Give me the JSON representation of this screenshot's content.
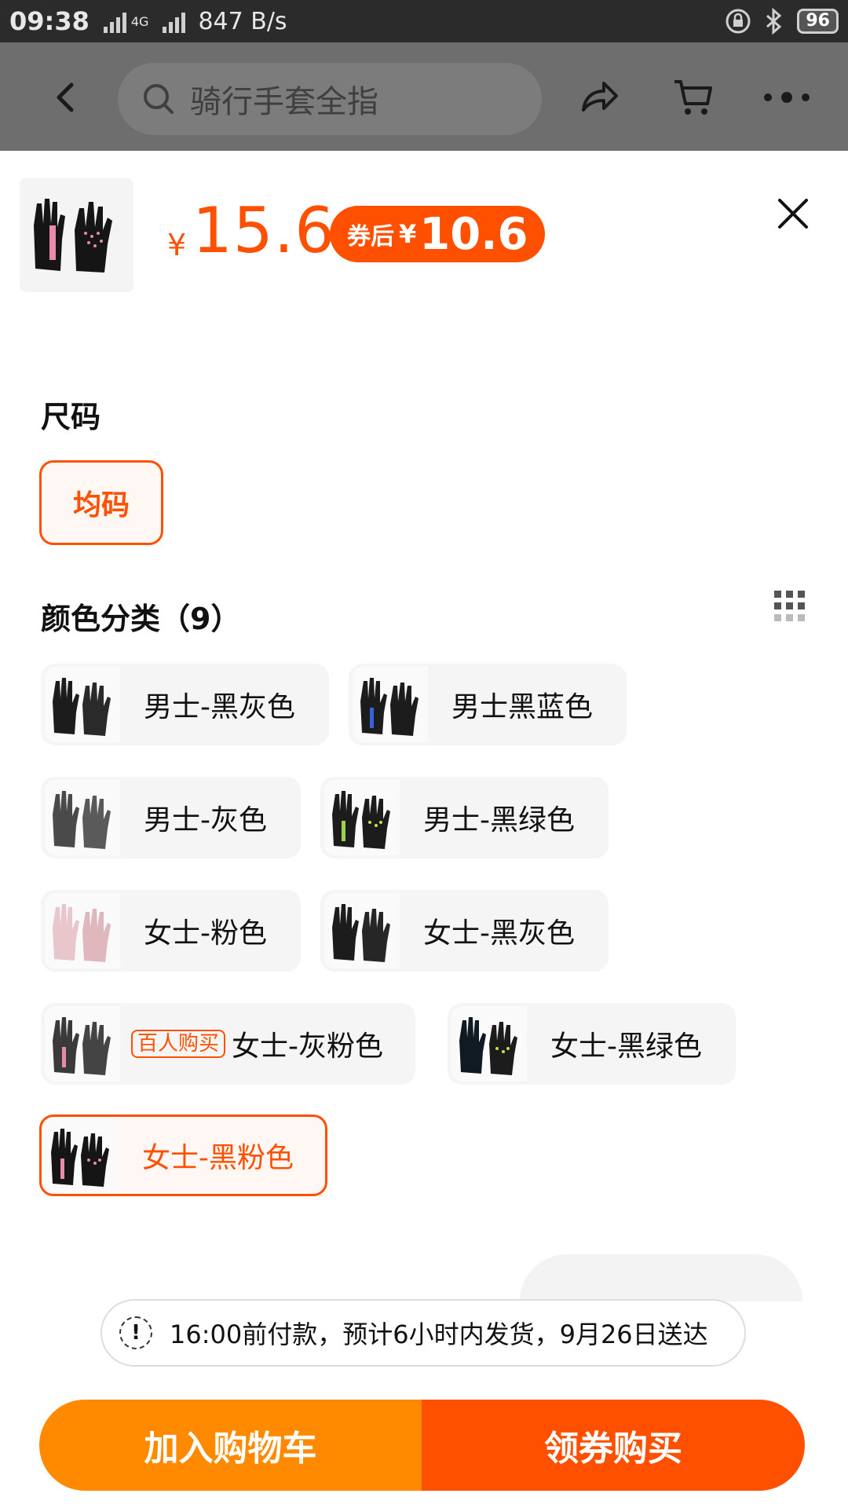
{
  "status_bar": {
    "time": "09:38",
    "network": "4G",
    "speed": "847 B/s",
    "battery": "96"
  },
  "header": {
    "search_placeholder": "骑行手套全指",
    "icons": [
      "back-icon",
      "search-icon",
      "share-icon",
      "cart-icon",
      "more-icon"
    ]
  },
  "product": {
    "price_symbol": "¥",
    "price": "15.6",
    "coupon_label": "券后",
    "coupon_symbol": "¥",
    "coupon_price": "10.6"
  },
  "size_section": {
    "title": "尺码",
    "options": [
      "均码"
    ]
  },
  "color_section": {
    "title": "颜色分类（9）",
    "options": [
      {
        "label": "男士-黑灰色"
      },
      {
        "label": "男士黑蓝色"
      },
      {
        "label": "男士-灰色"
      },
      {
        "label": "男士-黑绿色"
      },
      {
        "label": "女士-粉色"
      },
      {
        "label": "女士-黑灰色"
      },
      {
        "label": "女士-灰粉色",
        "badge": "百人购买"
      },
      {
        "label": "女士-黑绿色"
      },
      {
        "label": "女士-黑粉色",
        "selected": true
      }
    ]
  },
  "notice": {
    "text": "16:00前付款，预计6小时内发货，9月26日送达"
  },
  "actions": {
    "add_to_cart": "加入购物车",
    "buy_with_coupon": "领券购买"
  },
  "colors": {
    "accent": "#ff5000",
    "cart_button": "#ff8a00"
  }
}
